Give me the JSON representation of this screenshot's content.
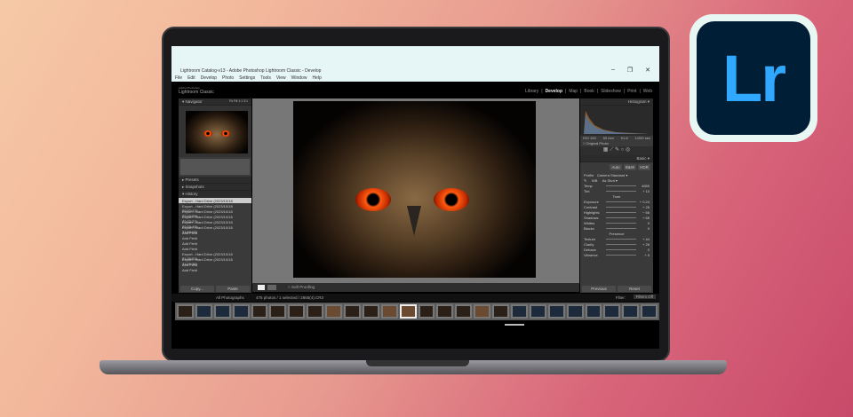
{
  "logo": {
    "text": "Lr",
    "bg": "#001e36",
    "fg": "#31a8ff"
  },
  "window": {
    "title": "Lightroom Catalog-v13 - Adobe Photoshop Lightroom Classic - Develop",
    "controls": [
      "–",
      "❐",
      "✕"
    ],
    "menu": [
      "File",
      "Edit",
      "Develop",
      "Photo",
      "Settings",
      "Tools",
      "View",
      "Window",
      "Help"
    ]
  },
  "app": {
    "brand_small": "Adobe Photoshop",
    "brand": "Lightroom Classic",
    "modules": [
      {
        "label": "Library",
        "active": false
      },
      {
        "label": "Develop",
        "active": true
      },
      {
        "label": "Map",
        "active": false
      },
      {
        "label": "Book",
        "active": false
      },
      {
        "label": "Slideshow",
        "active": false
      },
      {
        "label": "Print",
        "active": false
      },
      {
        "label": "Web",
        "active": false
      }
    ]
  },
  "left": {
    "navigator": "Navigator",
    "nav_zoom": "Fit  Fill  1:1  3:1",
    "presets": "Presets",
    "snapshots": "Snapshots",
    "history": "History",
    "history_items": [
      "Export - Hard Drive (2023/10/18 22:07:58)",
      "Export - Hard Drive (2023/10/18 22:07:17)",
      "Export - Hard Drive (2023/10/18 22:02:58)",
      "Export - Hard Drive (2023/10/18 22:02:27)",
      "Export - Hard Drive (2023/10/18 22:00:46)",
      "Export - Hard Drive (2023/10/18 21:59:09)",
      "Add Field",
      "Add Field",
      "Add Field",
      "Add Field",
      "Export - Hard Drive (2023/10/18 21:30:53)",
      "Export - Hard Drive (2023/10/18 21:29:36)",
      "Add Field",
      "Add Field"
    ],
    "copy": "Copy...",
    "paste": "Paste"
  },
  "right": {
    "histogram": "Histogram",
    "hist_info": [
      "ISO 100",
      "50 mm",
      "f/1.8",
      "1/200 sec"
    ],
    "original": "Original Photo",
    "basic": "Basic",
    "treatment": [
      "Auto",
      "B&W",
      "HDR"
    ],
    "profile_label": "Profile",
    "profile": "Camera Standard",
    "wb": "WB",
    "wb_value": "As Shot",
    "sliders": [
      {
        "label": "Temp",
        "value": "4650"
      },
      {
        "label": "Tint",
        "value": "+ 10"
      },
      {
        "label": "Tone",
        "value": ""
      },
      {
        "label": "Exposure",
        "value": "+ 0.24"
      },
      {
        "label": "Contrast",
        "value": "+ 26"
      },
      {
        "label": "Highlights",
        "value": "− 66"
      },
      {
        "label": "Shadows",
        "value": "+ 66"
      },
      {
        "label": "Whites",
        "value": "0"
      },
      {
        "label": "Blacks",
        "value": "0"
      },
      {
        "label": "Presence",
        "value": ""
      },
      {
        "label": "Texture",
        "value": "+ 44"
      },
      {
        "label": "Clarity",
        "value": "+ 28"
      },
      {
        "label": "Dehaze",
        "value": "0"
      },
      {
        "label": "Vibrance",
        "value": "+ 9"
      }
    ],
    "previous": "Previous",
    "reset": "Reset"
  },
  "toolbar": {
    "soft_proofing": "Soft Proofing"
  },
  "filmstrip": {
    "source": "All Photographs",
    "count": "475 photos / 1 selected / 2865(4).CR3",
    "filter_label": "Filter:",
    "filter": "Filters Off",
    "thumbs": 26,
    "selected_index": 12
  }
}
